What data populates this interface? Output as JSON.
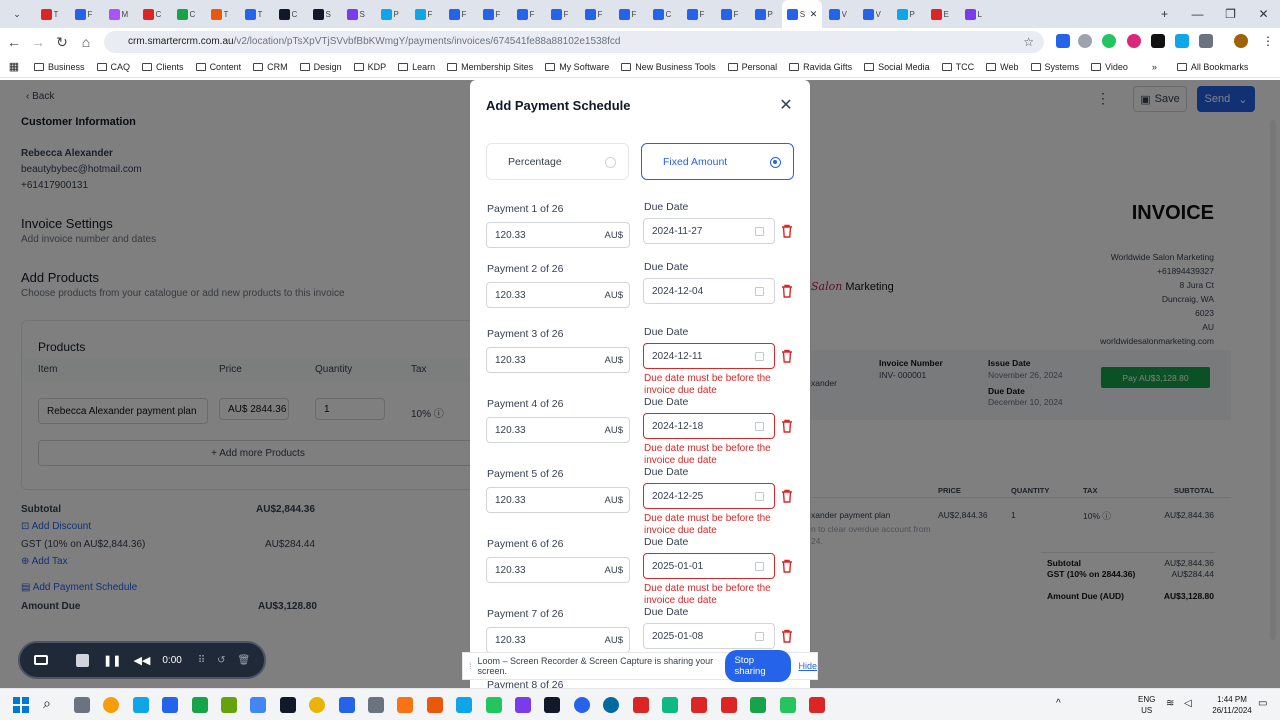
{
  "browser": {
    "url_host": "crm.smartercrm.com.au",
    "url_path": "/v2/location/pTsXpVTjSVvbfBbKWmgY/payments/invoices/674541fe88a88102e1538fcd",
    "bookmarks": [
      "Business",
      "CAQ",
      "Clients",
      "Content",
      "CRM",
      "Design",
      "KDP",
      "Learn",
      "Membership Sites",
      "My Software",
      "New Business Tools",
      "Personal",
      "Ravida Gifts",
      "Social Media",
      "TCC",
      "Web",
      "Systems",
      "Video"
    ],
    "all_bookmarks": "All Bookmarks",
    "tab_letters": [
      "T",
      "F",
      "M",
      "C",
      "C",
      "T",
      "T",
      "C",
      "S",
      "S",
      "P",
      "F",
      "F",
      "F",
      "F",
      "F",
      "F",
      "F",
      "C",
      "F",
      "F",
      "P",
      "S",
      "V",
      "V",
      "P",
      "E",
      "L"
    ]
  },
  "app": {
    "back": "Back",
    "save": "Save",
    "send": "Send",
    "customer_heading": "Customer Information",
    "customer_name": "Rebecca Alexander",
    "customer_email": "beautybybec@hotmail.com",
    "customer_phone": "+61417900131",
    "invoice_settings_heading": "Invoice Settings",
    "invoice_settings_sub": "Add invoice number and dates",
    "add_products_heading": "Add Products",
    "add_products_sub": "Choose products from your catalogue or add new products to this invoice",
    "products_title": "Products",
    "col_item": "Item",
    "col_price": "Price",
    "col_quantity": "Quantity",
    "col_tax": "Tax",
    "product_name": "Rebecca Alexander payment plan",
    "product_price": "AU$ 2844.36",
    "product_qty": "1",
    "product_tax": "10%",
    "add_more": "+ Add more Products",
    "subtotal_label": "Subtotal",
    "subtotal_value": "AU$2,844.36",
    "add_discount": "Add Discount",
    "gst_label": "GST (10% on AU$2,844.36)",
    "gst_value": "AU$284.44",
    "add_tax": "Add Tax",
    "add_payment_schedule": "Add Payment Schedule",
    "amount_due_label": "Amount Due",
    "amount_due_value": "AU$3,128.80"
  },
  "invoice_preview": {
    "title": "INVOICE",
    "company": "Worldwide Salon Marketing",
    "phone": "+61894439327",
    "street": "8 Jura Ct",
    "suburb": "Duncraig, WA",
    "postcode": "6023",
    "country": "AU",
    "website": "worldwidesalonmarketing.com",
    "logo_text": "Marketing",
    "logo_script": "Salon",
    "invoice_number_label": "Invoice Number",
    "invoice_number": "INV- 000001",
    "issue_date_label": "Issue Date",
    "issue_date": "November 26, 2024",
    "due_date_label": "Due Date",
    "due_date": "December 10, 2024",
    "bill_to_fragment": "xander",
    "pay_button": "Pay AU$3,128.80",
    "cols": [
      "PRICE",
      "QUANTITY",
      "TAX",
      "SUBTOTAL"
    ],
    "row_name": "xander payment plan",
    "row_desc1": "n to clear overdue account from",
    "row_desc2": "24.",
    "row_price": "AU$2,844.36",
    "row_qty": "1",
    "row_tax": "10%",
    "row_sub": "AU$2,844.36",
    "sum_subtotal_label": "Subtotal",
    "sum_subtotal": "AU$2,844.36",
    "sum_gst_label": "GST (10% on 2844.36)",
    "sum_gst": "AU$284.44",
    "sum_due_label": "Amount Due (AUD)",
    "sum_due": "AU$3,128.80"
  },
  "modal": {
    "title": "Add Payment Schedule",
    "opt_percentage": "Percentage",
    "opt_fixed": "Fixed Amount",
    "due_label": "Due Date",
    "error": "Due date must be before the invoice due date",
    "payments": [
      {
        "label": "Payment 1 of 26",
        "amount": "120.33",
        "currency": "AU$",
        "date": "2024-11-27",
        "error": false
      },
      {
        "label": "Payment 2 of 26",
        "amount": "120.33",
        "currency": "AU$",
        "date": "2024-12-04",
        "error": false
      },
      {
        "label": "Payment 3 of 26",
        "amount": "120.33",
        "currency": "AU$",
        "date": "2024-12-11",
        "error": true
      },
      {
        "label": "Payment 4 of 26",
        "amount": "120.33",
        "currency": "AU$",
        "date": "2024-12-18",
        "error": true
      },
      {
        "label": "Payment 5 of 26",
        "amount": "120.33",
        "currency": "AU$",
        "date": "2024-12-25",
        "error": true
      },
      {
        "label": "Payment 6 of 26",
        "amount": "120.33",
        "currency": "AU$",
        "date": "2025-01-01",
        "error": true
      },
      {
        "label": "Payment 7 of 26",
        "amount": "120.33",
        "currency": "AU$",
        "date": "2025-01-08",
        "error": false
      }
    ],
    "partial_label": "Payment 8 of 26"
  },
  "loom": {
    "message": "Loom – Screen Recorder & Screen Capture is sharing your screen.",
    "stop": "Stop sharing",
    "hide": "Hide",
    "timer": "0:00"
  },
  "taskbar": {
    "lang1": "ENG",
    "lang2": "US",
    "time": "1:44 PM",
    "date": "26/11/2024"
  },
  "colors": {
    "primary": "#2563eb",
    "error": "#dc2626",
    "pay_green": "#16a34a"
  }
}
